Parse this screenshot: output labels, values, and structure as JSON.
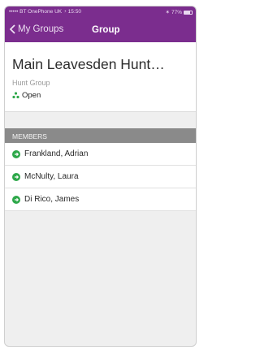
{
  "status_bar": {
    "carrier": "••••• BT OnePhone UK",
    "time": "15:50",
    "battery": "77%",
    "battery_level": 0.77
  },
  "nav": {
    "back_label": "My Groups",
    "title": "Group"
  },
  "group": {
    "name": "Main Leavesden Hunt…",
    "type": "Hunt Group",
    "status": "Open"
  },
  "members_section": {
    "title": "MEMBERS",
    "items": [
      {
        "name": "Frankland, Adrian"
      },
      {
        "name": "McNulty, Laura"
      },
      {
        "name": "Di Rico, James"
      }
    ]
  },
  "colors": {
    "brand": "#7b2d8e",
    "available": "#2ea84a",
    "section": "#8a8a8a"
  }
}
